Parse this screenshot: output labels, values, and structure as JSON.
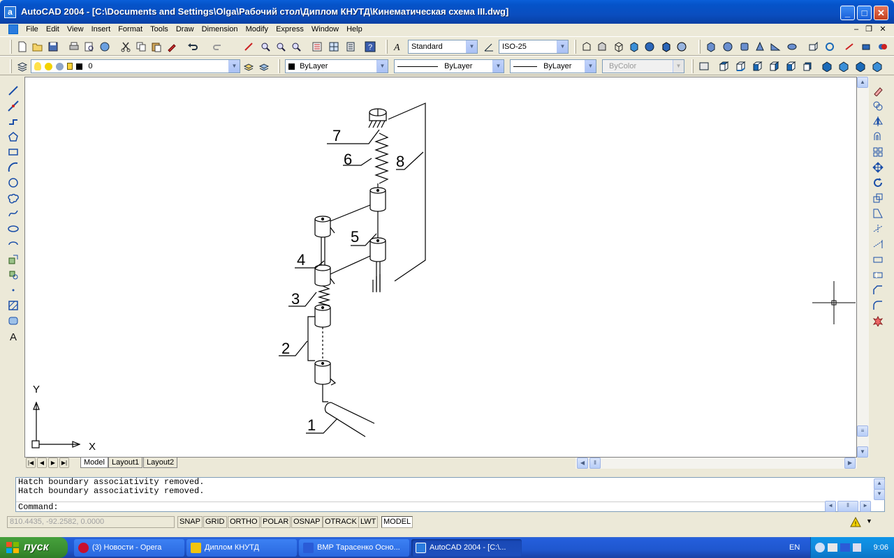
{
  "window": {
    "title": "AutoCAD 2004 - [C:\\Documents and Settings\\Olga\\Рабочий стол\\Диплом КНУТД\\Кинематическая схема III.dwg]",
    "app_icon": "autocad-icon",
    "buttons": {
      "minimize": "_",
      "maximize": "□",
      "close": "✕"
    }
  },
  "menu": {
    "items": [
      "File",
      "Edit",
      "View",
      "Insert",
      "Format",
      "Tools",
      "Draw",
      "Dimension",
      "Modify",
      "Express",
      "Window",
      "Help"
    ],
    "doc_buttons": {
      "minimize": "–",
      "restore": "❐",
      "close": "✕"
    }
  },
  "toolbar_standard": {
    "text_style": "Standard",
    "dim_style": "ISO-25"
  },
  "toolbar_layers": {
    "layer": "0",
    "color": "ByLayer",
    "linetype": "ByLayer",
    "lineweight": "ByLayer",
    "plotstyle": "ByColor"
  },
  "drawing": {
    "ucs": {
      "x_label": "X",
      "y_label": "Y"
    },
    "callouts": [
      "1",
      "2",
      "3",
      "4",
      "5",
      "6",
      "7",
      "8"
    ]
  },
  "layout_tabs": [
    "Model",
    "Layout1",
    "Layout2"
  ],
  "active_tab": "Model",
  "command": {
    "history": [
      "Hatch boundary associativity removed.",
      "Hatch boundary associativity removed."
    ],
    "prompt": "Command:"
  },
  "status": {
    "coords": "810.4435, -92.2582, 0.0000",
    "toggles": [
      "SNAP",
      "GRID",
      "ORTHO",
      "POLAR",
      "OSNAP",
      "OTRACK",
      "LWT",
      "MODEL"
    ],
    "active_toggle": "MODEL"
  },
  "taskbar": {
    "start_label": "пуск",
    "tasks": [
      {
        "label": "(3) Новости - Opera",
        "icon": "opera-icon",
        "color": "#c8102e"
      },
      {
        "label": "Диплом КНУТД",
        "icon": "folder-icon",
        "color": "#f1c40f"
      },
      {
        "label": "ВМР Тарасенко Осно...",
        "icon": "word-icon",
        "color": "#2a5bd7"
      },
      {
        "label": "AutoCAD 2004 - [C:\\...",
        "icon": "autocad-icon",
        "color": "#2a7bde"
      }
    ],
    "language": "EN",
    "clock": "9:06"
  }
}
